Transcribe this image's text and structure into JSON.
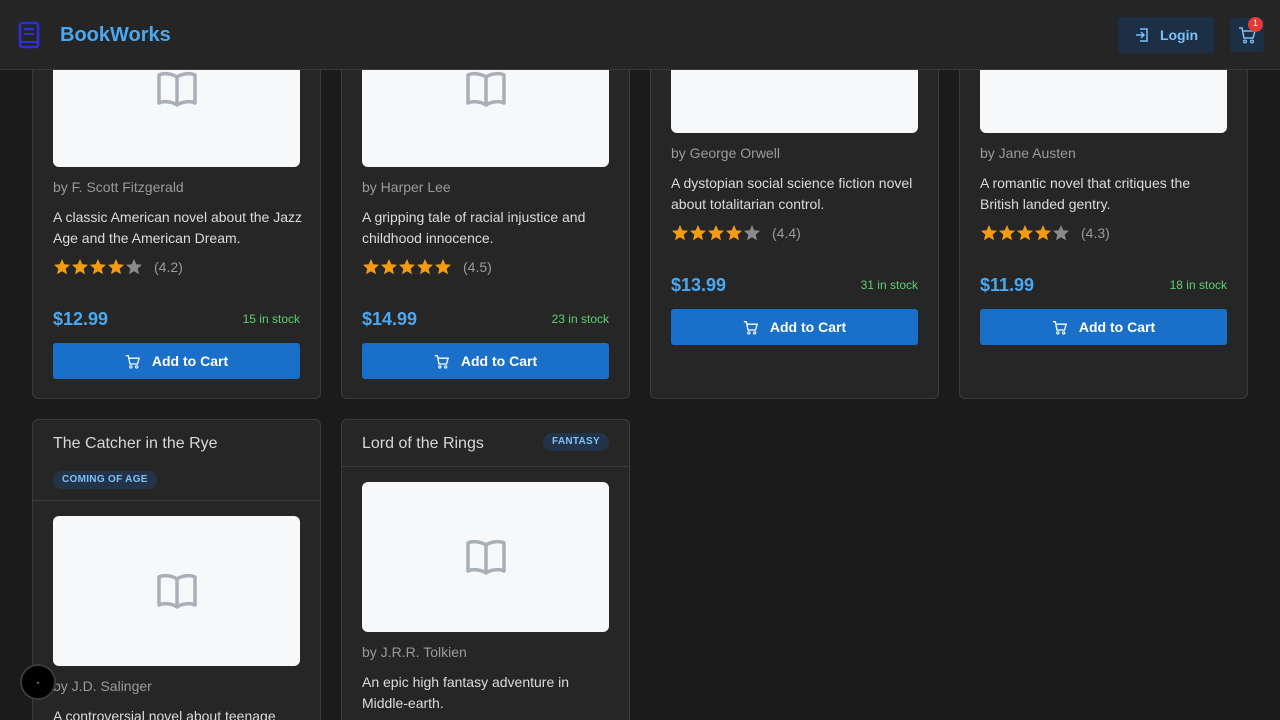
{
  "header": {
    "brand": "BookWorks",
    "login_label": "Login",
    "cart_count": "1"
  },
  "colors": {
    "accent": "#4aa8f0",
    "button": "#1a6fc9",
    "stock_green": "#5fcf6e",
    "star": "#f39c12"
  },
  "books": [
    {
      "author": "by F. Scott Fitzgerald",
      "desc": "A classic American novel about the Jazz Age and the American Dream.",
      "rating": 4.2,
      "rating_text": "(4.2)",
      "price": "$12.99",
      "stock": "15 in stock",
      "cta": "Add to Cart"
    },
    {
      "author": "by Harper Lee",
      "desc": "A gripping tale of racial injustice and childhood innocence.",
      "rating": 4.5,
      "rating_text": "(4.5)",
      "price": "$14.99",
      "stock": "23 in stock",
      "cta": "Add to Cart"
    },
    {
      "author": "by George Orwell",
      "desc": "A dystopian social science fiction novel about totalitarian control.",
      "rating": 4.4,
      "rating_text": "(4.4)",
      "price": "$13.99",
      "stock": "31 in stock",
      "cta": "Add to Cart"
    },
    {
      "author": "by Jane Austen",
      "desc": "A romantic novel that critiques the British landed gentry.",
      "rating": 4.3,
      "rating_text": "(4.3)",
      "price": "$11.99",
      "stock": "18 in stock",
      "cta": "Add to Cart"
    },
    {
      "title": "The Catcher in the Rye",
      "genre": "COMING OF AGE",
      "author": "by J.D. Salinger",
      "desc": "A controversial novel about teenage"
    },
    {
      "title": "Lord of the Rings",
      "genre": "FANTASY",
      "author": "by J.R.R. Tolkien",
      "desc": "An epic high fantasy adventure in Middle-earth."
    }
  ]
}
